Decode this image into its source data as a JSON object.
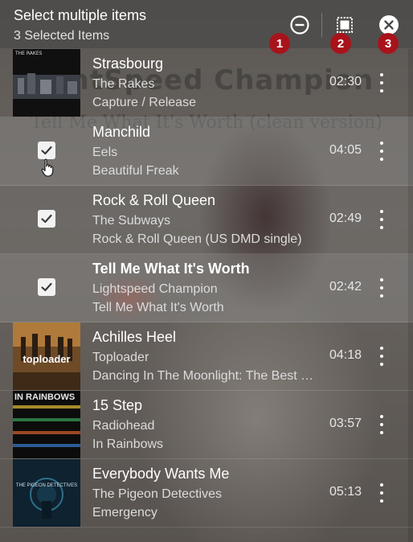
{
  "header": {
    "title": "Select multiple items",
    "subtitle": "3 Selected Items",
    "buttons": [
      {
        "icon": "deselect-circle-icon",
        "marker": "1"
      },
      {
        "icon": "select-all-icon",
        "marker": "2"
      },
      {
        "icon": "close-circle-icon",
        "marker": "3"
      }
    ]
  },
  "background_text": {
    "line1": "ightSpeed Champion",
    "line2": "Tell Me What It's Worth (clean version)"
  },
  "colors": {
    "marker": "#a8131b",
    "checkbox": "#f2f2f2"
  },
  "tracks": [
    {
      "title": "Strasbourg",
      "artist": "The Rakes",
      "album": "Capture / Release",
      "duration": "02:30",
      "selected": false,
      "cover_text": "THE RAKES"
    },
    {
      "title": "Manchild",
      "artist": "Eels",
      "album": "Beautiful Freak",
      "duration": "04:05",
      "selected": true
    },
    {
      "title": "Rock & Roll Queen",
      "artist": "The Subways",
      "album": "Rock & Roll Queen (US DMD single)",
      "duration": "02:49",
      "selected": true
    },
    {
      "title": "Tell Me What It's Worth",
      "artist": "Lightspeed Champion",
      "album": "Tell Me What It's Worth",
      "duration": "02:42",
      "selected": true
    },
    {
      "title": "Achilles Heel",
      "artist": "Toploader",
      "album": "Dancing In The Moonlight: The Best Of Toploader",
      "duration": "04:18",
      "selected": false,
      "cover_text": "toploader"
    },
    {
      "title": "15 Step",
      "artist": "Radiohead",
      "album": "In Rainbows",
      "duration": "03:57",
      "selected": false,
      "cover_text": "IN RAINBOWS"
    },
    {
      "title": "Everybody Wants Me",
      "artist": "The Pigeon Detectives",
      "album": "Emergency",
      "duration": "05:13",
      "selected": false,
      "cover_text": "THE PIGEON DETECTIVES"
    }
  ]
}
